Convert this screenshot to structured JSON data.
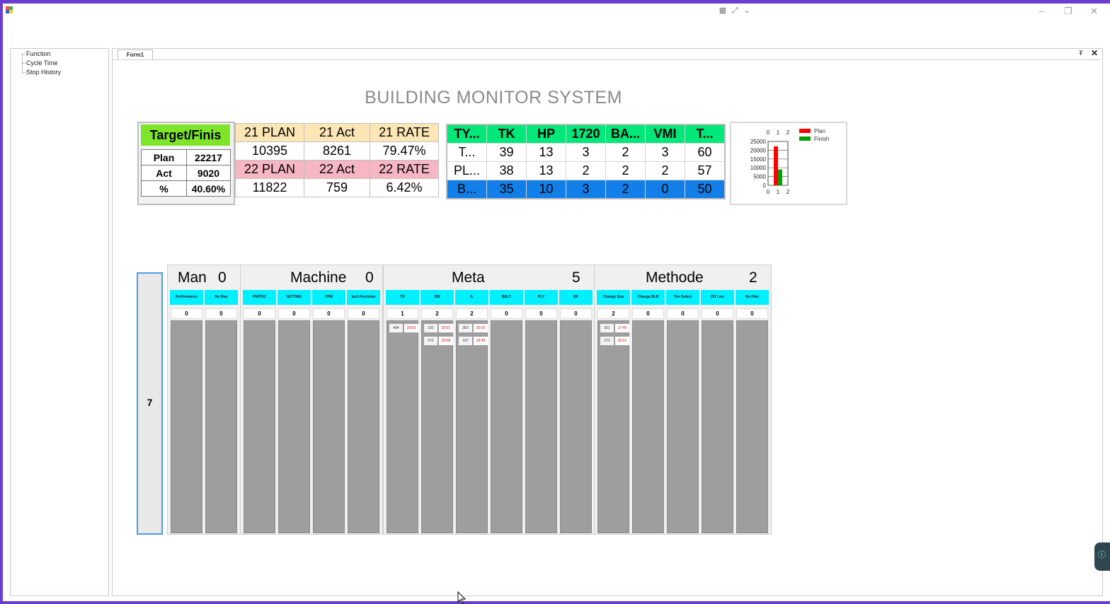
{
  "window": {
    "minimize": "–",
    "restore": "❐",
    "close": "✕"
  },
  "tree": {
    "items": [
      "Function",
      "Cycle Time",
      "Stop History"
    ]
  },
  "doc": {
    "tab_label": "Form1",
    "pin": "₮",
    "close": "✕"
  },
  "title": "BUILDING MONITOR SYSTEM",
  "target": {
    "header": "Target/Finis",
    "rows": [
      {
        "label": "Plan",
        "value": "22217"
      },
      {
        "label": "Act",
        "value": "9020"
      },
      {
        "label": "%",
        "value": "40.60%"
      }
    ]
  },
  "years": {
    "h21": [
      "21 PLAN",
      "21 Act",
      "21 RATE"
    ],
    "v21": [
      "10395",
      "8261",
      "79.47%"
    ],
    "h22": [
      "22 PLAN",
      "22 Act",
      "22 RATE"
    ],
    "v22": [
      "11822",
      "759",
      "6.42%"
    ]
  },
  "types": {
    "headers": [
      "TY...",
      "TK",
      "HP",
      "1720",
      "BA...",
      "VMI",
      "T..."
    ],
    "rows": [
      [
        "T...",
        "39",
        "13",
        "3",
        "2",
        "3",
        "60"
      ],
      [
        "PL...",
        "38",
        "13",
        "2",
        "2",
        "2",
        "57"
      ],
      [
        "B...",
        "35",
        "10",
        "3",
        "2",
        "0",
        "50"
      ]
    ]
  },
  "chart_data": {
    "type": "bar",
    "categories": [
      "1"
    ],
    "series": [
      {
        "name": "Plan",
        "values": [
          22217
        ],
        "color": "#ff0000"
      },
      {
        "name": "Finish",
        "values": [
          9020
        ],
        "color": "#00a000"
      }
    ],
    "x_ticks": [
      "0",
      "1",
      "2"
    ],
    "y_ticks": [
      "25000",
      "20000",
      "15000",
      "10000",
      "5000",
      "0"
    ],
    "ylim": [
      0,
      25000
    ],
    "legend": "top-right"
  },
  "side_button": "7",
  "groups": [
    {
      "name": "Man",
      "count": "0",
      "columns": [
        {
          "label": "Performance",
          "count": "0",
          "cards": []
        },
        {
          "label": "No Man",
          "count": "0",
          "cards": []
        }
      ]
    },
    {
      "name": "Machine",
      "count": "0",
      "columns": [
        {
          "label": "PM/PSC",
          "count": "0",
          "cards": []
        },
        {
          "label": "SETTING",
          "count": "0",
          "cards": []
        },
        {
          "label": "TPM",
          "count": "0",
          "cards": []
        },
        {
          "label": "lack Precision",
          "count": "0",
          "cards": []
        }
      ]
    },
    {
      "name": "Meta",
      "count": "5",
      "columns": [
        {
          "label": "TR",
          "count": "1",
          "cards": [
            {
              "id": "404",
              "val": "20:03"
            }
          ]
        },
        {
          "label": "SW",
          "count": "2",
          "cards": [
            {
              "id": "102",
              "val": "20:01"
            },
            {
              "id": "072",
              "val": "20:08"
            }
          ]
        },
        {
          "label": "IL",
          "count": "2",
          "cards": [
            {
              "id": "303",
              "val": "20:03"
            },
            {
              "id": "107",
              "val": "20:40"
            }
          ]
        },
        {
          "label": "BELT",
          "count": "0",
          "cards": []
        },
        {
          "label": "PLY",
          "count": "0",
          "cards": []
        },
        {
          "label": "BF",
          "count": "0",
          "cards": []
        }
      ]
    },
    {
      "name": "Methode",
      "count": "2",
      "columns": [
        {
          "label": "Change Size",
          "count": "2",
          "cards": [
            {
              "id": "301",
              "val": "17:40"
            },
            {
              "id": "273",
              "val": "20:01"
            }
          ]
        },
        {
          "label": "Change BLR",
          "count": "0",
          "cards": []
        },
        {
          "label": "Tire Defect",
          "count": "0",
          "cards": []
        },
        {
          "label": "Off Line",
          "count": "0",
          "cards": []
        },
        {
          "label": "No Plan",
          "count": "0",
          "cards": []
        }
      ]
    }
  ]
}
